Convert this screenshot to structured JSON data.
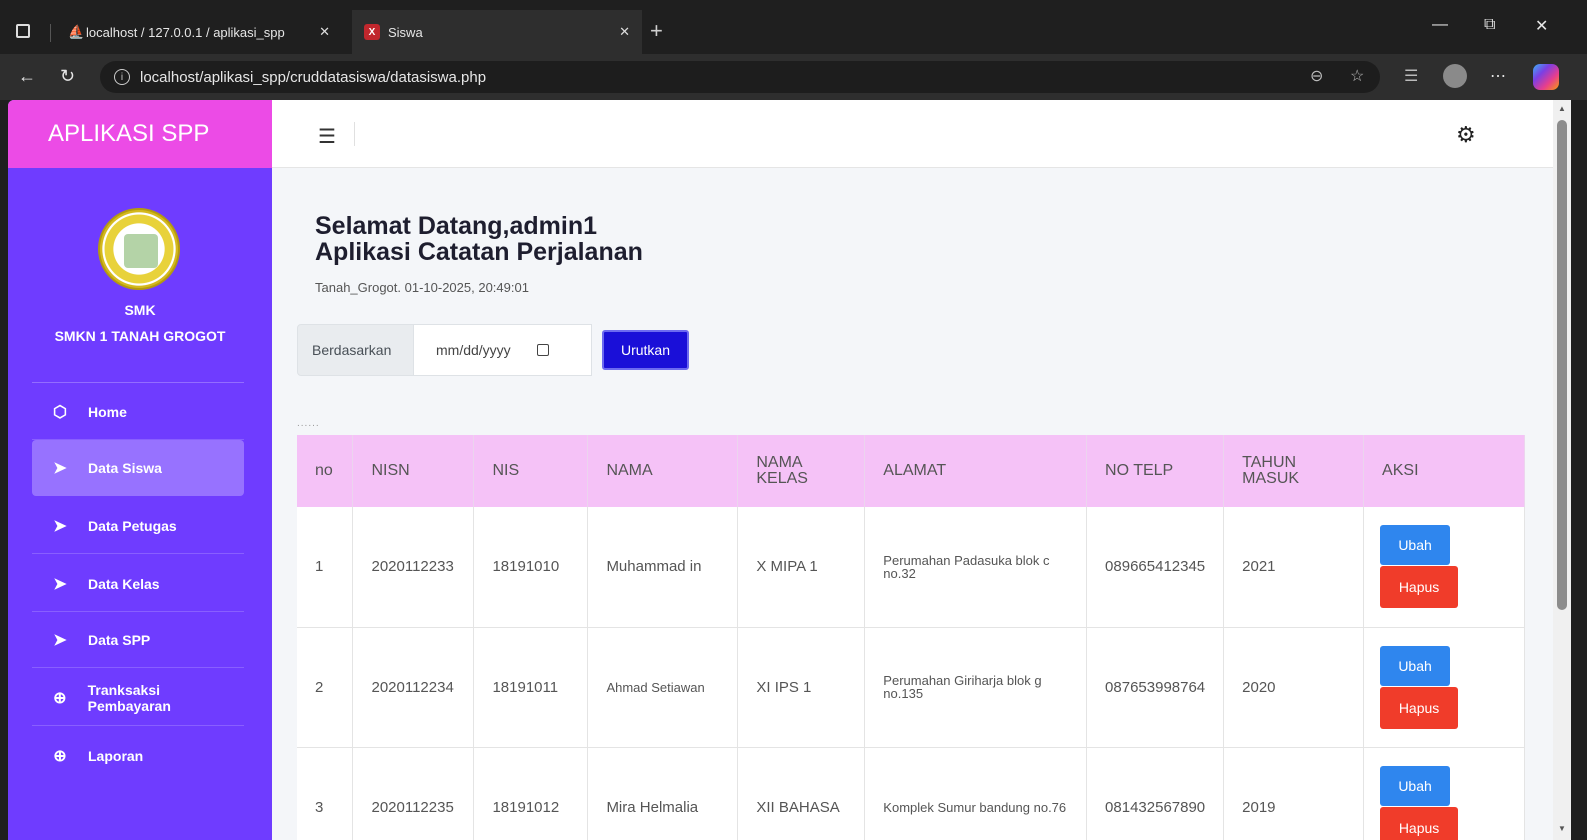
{
  "browser": {
    "tabs": [
      {
        "title": "localhost / 127.0.0.1 / aplikasi_spp"
      },
      {
        "title": "Siswa"
      }
    ],
    "tab_close": "✕",
    "url": "localhost/aplikasi_spp/cruddatasiswa/datasiswa.php",
    "favicon_letter": "X"
  },
  "app": {
    "brand": "APLIKASI SPP",
    "school_type": "SMK",
    "school_name": "SMKN 1 TANAH GROGOT",
    "accent_color": "#6f3cff",
    "brand_color": "#ec4be6",
    "menu": [
      {
        "label": "Home",
        "icon": "cube-icon"
      },
      {
        "label": "Data Siswa",
        "icon": "send-icon",
        "active": true
      },
      {
        "label": "Data Petugas",
        "icon": "send-icon"
      },
      {
        "label": "Data Kelas",
        "icon": "send-icon"
      },
      {
        "label": "Data SPP",
        "icon": "send-icon"
      },
      {
        "label": "Tranksaksi Pembayaran",
        "icon": "plus-circle-icon"
      },
      {
        "label": "Laporan",
        "icon": "plus-circle-icon"
      }
    ]
  },
  "content": {
    "greeting": "Selamat Datang,admin1",
    "subtitle": "Aplikasi Catatan Perjalanan",
    "datetime": "Tanah_Grogot. 01-10-2025, 20:49:01",
    "filter": {
      "label": "Berdasarkan",
      "date_placeholder": "mm/dd/yyyy",
      "button": "Urutkan"
    },
    "dots": "......",
    "table": {
      "header_color": "#f5c2f7",
      "columns": [
        "no",
        "NISN",
        "NIS",
        "NAMA",
        "NAMA KELAS",
        "ALAMAT",
        "NO TELP",
        "TAHUN MASUK",
        "AKSI"
      ],
      "rows": [
        {
          "no": "1",
          "nisn": "2020112233",
          "nis": "18191010",
          "nama": "Muhammad in",
          "kelas": "X MIPA 1",
          "alamat": "Perumahan Padasuka blok c no.32",
          "telp": "089665412345",
          "tahun": "2021"
        },
        {
          "no": "2",
          "nisn": "2020112234",
          "nis": "18191011",
          "nama": "Ahmad Setiawan",
          "kelas": "XI IPS 1",
          "alamat": "Perumahan Giriharja blok g no.135",
          "telp": "087653998764",
          "tahun": "2020"
        },
        {
          "no": "3",
          "nisn": "2020112235",
          "nis": "18191012",
          "nama": "Mira Helmalia",
          "kelas": "XII BAHASA",
          "alamat": "Komplek Sumur bandung no.76",
          "telp": "081432567890",
          "tahun": "2019"
        }
      ],
      "edit_label": "Ubah",
      "delete_label": "Hapus"
    }
  }
}
